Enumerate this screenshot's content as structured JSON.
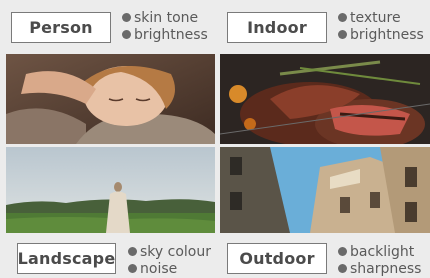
{
  "categories": [
    {
      "label": "Person",
      "features": [
        "skin tone",
        "brightness"
      ]
    },
    {
      "label": "Indoor",
      "features": [
        "texture",
        "brightness"
      ]
    },
    {
      "label": "Landscape",
      "features": [
        "sky colour",
        "noise"
      ]
    },
    {
      "label": "Outdoor",
      "features": [
        "backlight",
        "sharpness"
      ]
    }
  ],
  "photos": [
    {
      "subject": "sleeping-child"
    },
    {
      "subject": "grilled-steak"
    },
    {
      "subject": "woman-in-field"
    },
    {
      "subject": "building-facade"
    }
  ]
}
